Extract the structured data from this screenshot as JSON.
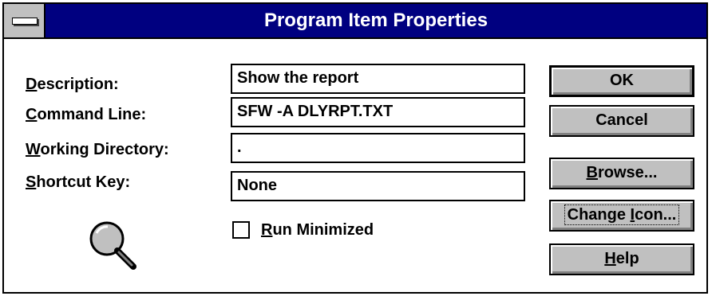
{
  "dialog": {
    "title": "Program Item Properties"
  },
  "fields": {
    "description": {
      "label_mnemonic": "D",
      "label_rest": "escription:",
      "value": "Show the report"
    },
    "command_line": {
      "label_mnemonic": "C",
      "label_rest": "ommand Line:",
      "value": "SFW -A DLYRPT.TXT"
    },
    "working_directory": {
      "label_mnemonic": "W",
      "label_rest": "orking Directory:",
      "value": "."
    },
    "shortcut_key": {
      "label_mnemonic": "S",
      "label_rest": "hortcut Key:",
      "value": "None"
    }
  },
  "run_minimized": {
    "mnemonic": "R",
    "rest": "un Minimized",
    "checked": false
  },
  "buttons": {
    "ok": "OK",
    "cancel": "Cancel",
    "browse": {
      "mnemonic": "B",
      "rest": "rowse..."
    },
    "change_icon": {
      "before": "Change ",
      "mnemonic": "I",
      "rest": "con..."
    },
    "help": {
      "mnemonic": "H",
      "rest": "elp"
    }
  },
  "program_icon": "magnifying-glass-icon"
}
